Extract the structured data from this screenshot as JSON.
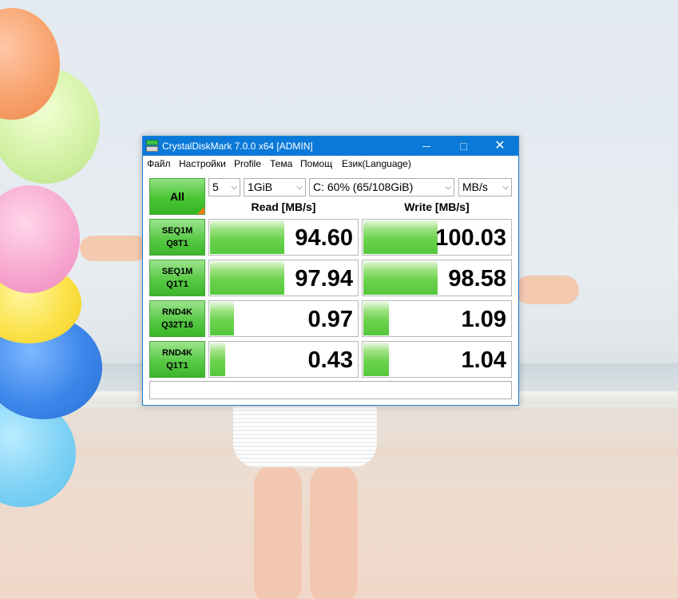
{
  "window": {
    "title": "CrystalDiskMark 7.0.0 x64 [ADMIN]",
    "controls": {
      "minimize_icon": "minimize-icon",
      "maximize_icon": "maximize-icon",
      "close_icon": "close-icon",
      "close_glyph": "✕"
    }
  },
  "menu": [
    {
      "label": "Файл"
    },
    {
      "label": "Настройки"
    },
    {
      "label": "Profile"
    },
    {
      "label": "Тема"
    },
    {
      "label": "Помощ"
    },
    {
      "label": "Език(Language)"
    }
  ],
  "controls": {
    "all_label": "All",
    "count": "5",
    "size": "1GiB",
    "drive": "C: 60% (65/108GiB)",
    "unit": "MB/s",
    "chevron": "⌵"
  },
  "headers": {
    "read": "Read [MB/s]",
    "write": "Write [MB/s]"
  },
  "tests": [
    {
      "line1": "SEQ1M",
      "line2": "Q8T1",
      "read": "94.60",
      "write": "100.03",
      "read_fill": 0.5,
      "write_fill": 0.5
    },
    {
      "line1": "SEQ1M",
      "line2": "Q1T1",
      "read": "97.94",
      "write": "98.58",
      "read_fill": 0.5,
      "write_fill": 0.5
    },
    {
      "line1": "RND4K",
      "line2": "Q32T16",
      "read": "0.97",
      "write": "1.09",
      "read_fill": 0.16,
      "write_fill": 0.17
    },
    {
      "line1": "RND4K",
      "line2": "Q1T1",
      "read": "0.43",
      "write": "1.04",
      "read_fill": 0.1,
      "write_fill": 0.17
    }
  ],
  "comment": "",
  "colors": {
    "accent": "#0a79d8",
    "bar_green": "#55c83b",
    "all_marker": "#f07a14"
  }
}
